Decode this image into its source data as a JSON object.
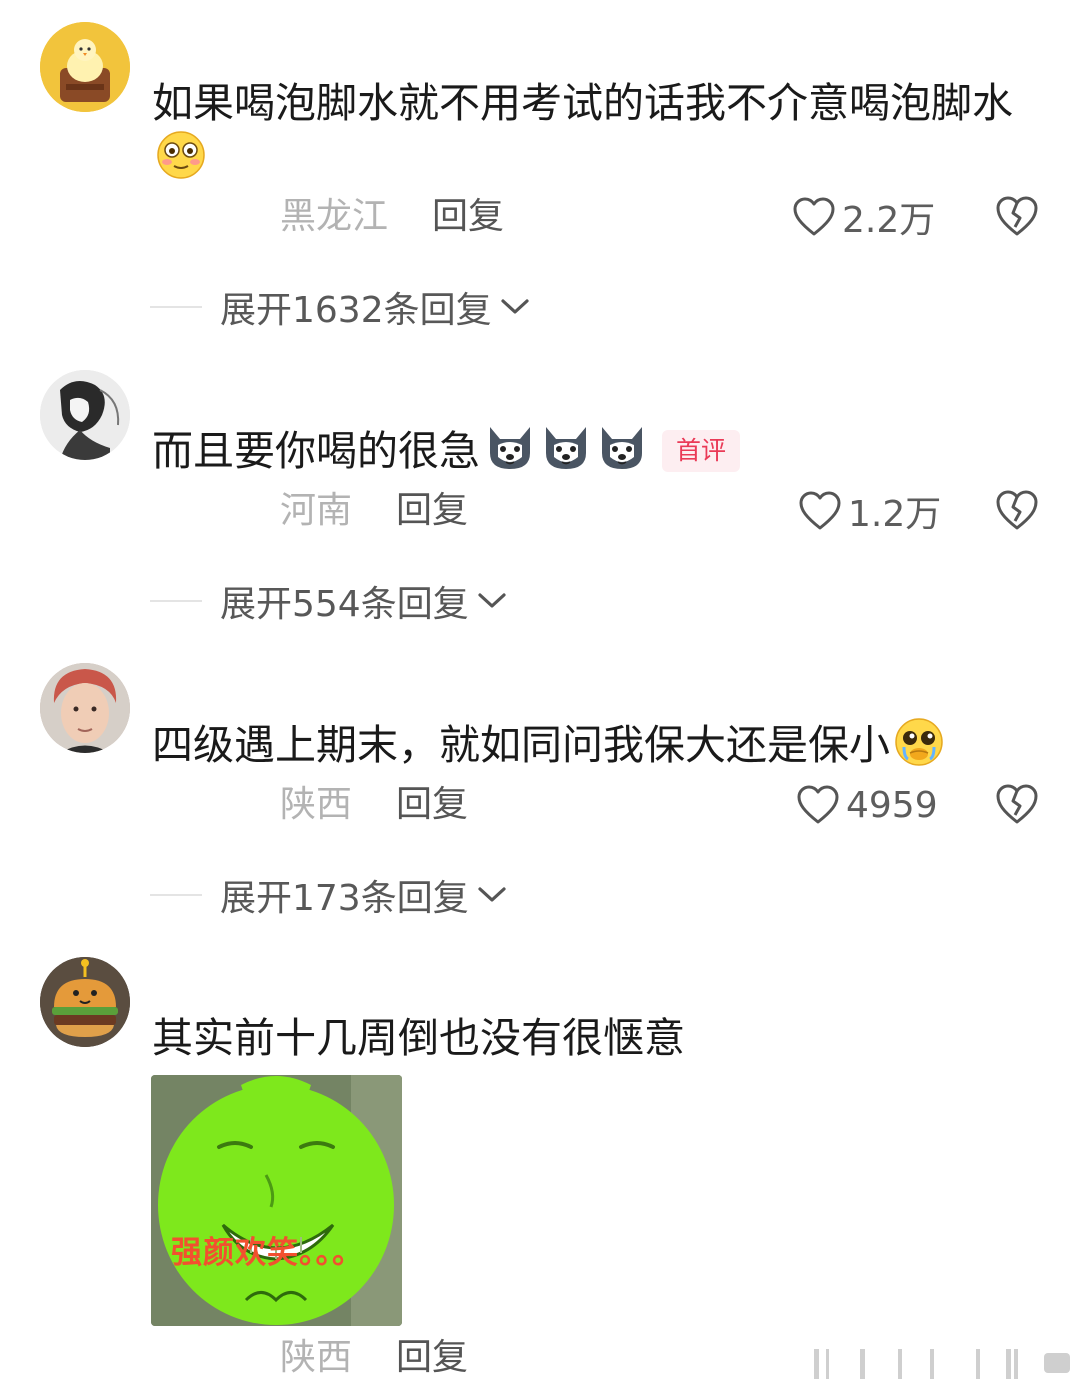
{
  "comments": [
    {
      "text": "如果喝泡脚水就不用考试的话我不介意喝泡脚水",
      "region": "黑龙江",
      "reply_label": "回复",
      "likes": "2.2万",
      "expand_label": "展开1632条回复",
      "emoji_icons": [
        "flushed-face-icon"
      ]
    },
    {
      "text": "而且要你喝的很急",
      "badge": "首评",
      "region": "河南",
      "reply_label": "回复",
      "likes": "1.2万",
      "expand_label": "展开554条回复",
      "emoji_icons": [
        "husky-dog-icon",
        "husky-dog-icon",
        "husky-dog-icon"
      ]
    },
    {
      "text": "四级遇上期末，就如同问我保大还是保小",
      "region": "陕西",
      "reply_label": "回复",
      "likes": "4959",
      "expand_label": "展开173条回复",
      "emoji_icons": [
        "pleading-face-icon"
      ]
    },
    {
      "text": "其实前十几周倒也没有很惬意",
      "sticker_caption": "强颜欢笑。。。",
      "region": "陕西",
      "reply_label": "回复"
    }
  ],
  "colors": {
    "badge_text": "#ea3a57",
    "badge_bg": "#fdeef1",
    "region_text": "#b3b3b3",
    "sticker_green": "#7ee81c"
  }
}
